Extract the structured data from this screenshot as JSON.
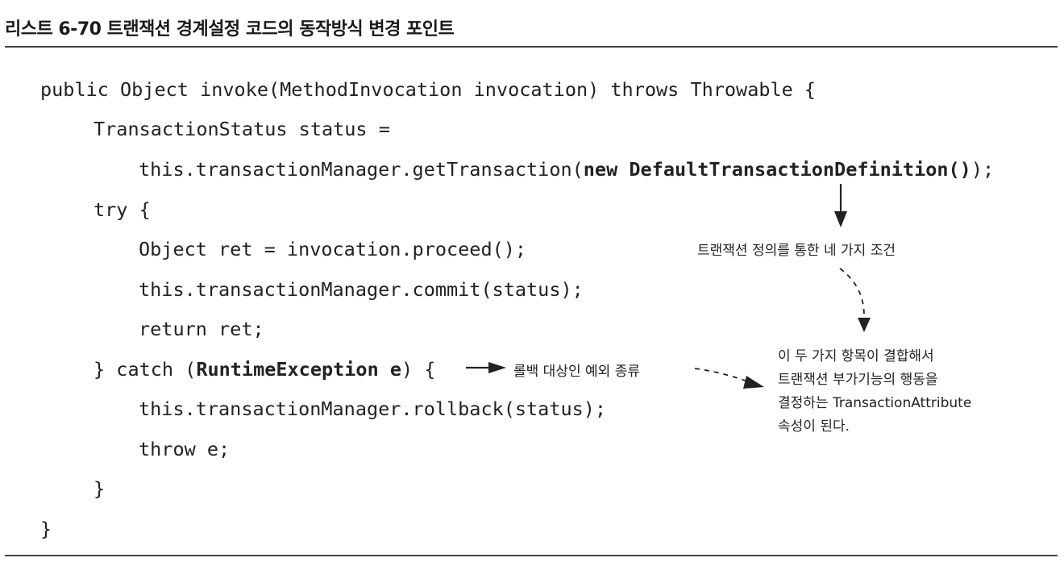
{
  "title": "리스트 6-70 트랜잭션 경계설정 코드의 동작방식 변경 포인트",
  "code": {
    "line1": "public Object invoke(MethodInvocation invocation) throws Throwable {",
    "line2": "TransactionStatus status =",
    "line3_pre": "this.transactionManager.getTransaction(",
    "line3_bold": "new DefaultTransactionDefinition()",
    "line3_post": ");",
    "line4": "try {",
    "line5": "Object ret = invocation.proceed();",
    "line6": "this.transactionManager.commit(status);",
    "line7": "return ret;",
    "line8_pre": "} catch (",
    "line8_bold": "RuntimeException e",
    "line8_post": ") {",
    "line9": "this.transactionManager.rollback(status);",
    "line10": "throw e;",
    "line11": "}",
    "line12": "}"
  },
  "annotations": {
    "definition_note": "트랜잭션 정의를 통한 네 가지 조건",
    "rollback_note": "롤백 대상인 예외 종류",
    "attribute_note": [
      "이 두 가지 항목이 결합해서",
      "트랜잭션 부가기능의 행동을",
      "결정하는 TransactionAttribute",
      "속성이 된다."
    ]
  }
}
